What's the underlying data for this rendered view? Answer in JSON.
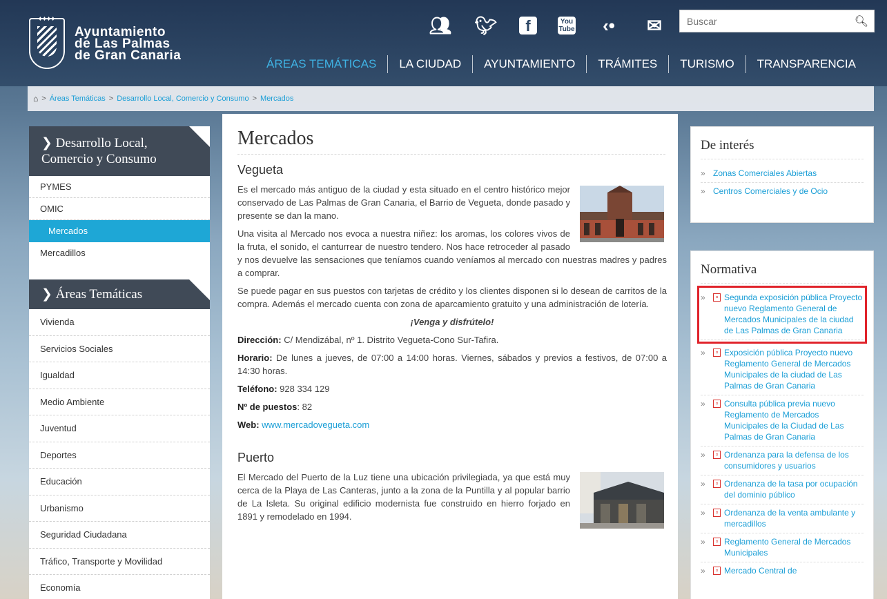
{
  "header": {
    "logo_line1": "Ayuntamiento",
    "logo_line2": "de Las Palmas",
    "logo_line3": "de Gran Canaria",
    "search_placeholder": "Buscar",
    "youtube_top": "You",
    "youtube_bottom": "Tube",
    "nav": [
      "ÁREAS TEMÁTICAS",
      "LA CIUDAD",
      "AYUNTAMIENTO",
      "TRÁMITES",
      "TURISMO",
      "TRANSPARENCIA"
    ],
    "social_icons": [
      "people-icon",
      "twitter-icon",
      "facebook-icon",
      "youtube-icon",
      "share-icon",
      "mail-icon"
    ]
  },
  "breadcrumb": [
    "Áreas Temáticas",
    "Desarrollo Local, Comercio y Consumo",
    "Mercados"
  ],
  "sidebar": {
    "section1_title": "Desarrollo Local, Comercio y Consumo",
    "section1_items": [
      "PYMES",
      "OMIC",
      "Mercados",
      "Mercadillos"
    ],
    "section2_title": "Áreas Temáticas",
    "section2_items": [
      "Vivienda",
      "Servicios Sociales",
      "Igualdad",
      "Medio Ambiente",
      "Juventud",
      "Deportes",
      "Educación",
      "Urbanismo",
      "Seguridad Ciudadana",
      "Tráfico, Transporte y Movilidad",
      "Economía"
    ]
  },
  "main": {
    "title": "Mercados",
    "vegueta": {
      "title": "Vegueta",
      "p1": "Es el mercado más antiguo de la ciudad y esta situado en el centro histórico mejor conservado de Las Palmas de Gran Canaria, el Barrio de Vegueta, donde pasado y presente se dan la mano.",
      "p2": "Una visita al Mercado  nos evoca a nuestra niñez: los aromas, los colores vivos de la fruta, el sonido, el canturrear de nuestro tendero. Nos hace retroceder al pasado y nos devuelve las sensaciones que teníamos cuando veníamos al mercado con nuestras madres y padres a comprar.",
      "p3": "Se puede pagar en sus puestos con tarjetas de crédito y los clientes disponen si lo desean de carritos de la compra. Además el mercado cuenta con zona de aparcamiento gratuito y una administración de lotería.",
      "slogan": "¡Venga y disfrútelo!",
      "direccion_label": "Dirección:",
      "direccion": " C/ Mendizábal, nº 1. Distrito Vegueta-Cono Sur-Tafira.",
      "horario_label": "Horario:",
      "horario": " De lunes a jueves, de 07:00 a 14:00 horas. Viernes, sábados y previos a festivos, de 07:00 a 14:30 horas.",
      "telefono_label": "Teléfono:",
      "telefono": " 928 334 129",
      "puestos_label": "Nº de puestos",
      "puestos": ": 82",
      "web_label": "Web:",
      "web": "www.mercadovegueta.com"
    },
    "puerto": {
      "title": "Puerto",
      "p1": "El Mercado del Puerto de la Luz tiene una ubicación privilegiada, ya que está muy cerca de la Playa de Las Canteras, junto a la zona de la Puntilla y al popular barrio de La Isleta. Su original edificio modernista fue construido en hierro forjado en 1891 y remodelado en 1994."
    }
  },
  "right": {
    "interes_title": "De interés",
    "interes_links": [
      "Zonas Comerciales Abiertas",
      "Centros Comerciales y de Ocio"
    ],
    "normativa_title": "Normativa",
    "normativa_links": [
      "Segunda exposición pública Proyecto nuevo Reglamento General de Mercados Municipales de la ciudad de Las Palmas de Gran Canaria",
      "Exposición pública Proyecto nuevo Reglamento General de Mercados Municipales de la ciudad de Las Palmas de Gran Canaria",
      "Consulta pública previa nuevo Reglamento de Mercados Municipales de la Ciudad de Las Palmas de Gran Canaria",
      "Ordenanza para la defensa de los consumidores y usuarios",
      "Ordenanza de la tasa por ocupación del dominio público",
      "Ordenanza de la venta ambulante y mercadillos",
      "Reglamento General de Mercados Municipales",
      "Mercado Central de"
    ]
  },
  "colors": {
    "accent": "#1ea7d6",
    "sidebar_header": "#404a57",
    "highlight": "#e0232b"
  }
}
